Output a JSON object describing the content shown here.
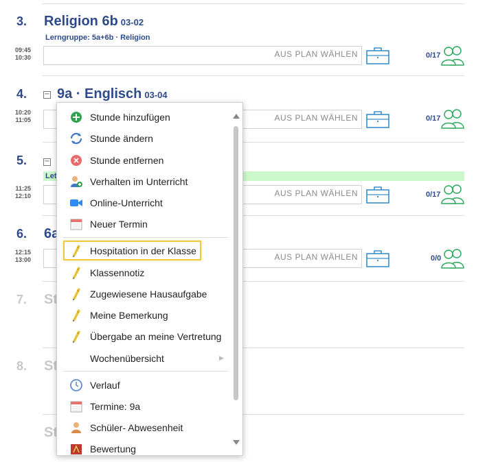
{
  "lessons": [
    {
      "number": "3.",
      "title": "Religion  6b",
      "code": "03-02",
      "subtitle": "Lerngruppe:  5a+6b · Religion",
      "time_start": "09:45",
      "time_end": "10:30",
      "plan_label": "AUS PLAN WÄHLEN",
      "count": "0/17"
    },
    {
      "number": "4.",
      "title": "9a · Englisch",
      "code": "03-04",
      "time_start": "10:20",
      "time_end": "11:05",
      "plan_label": "AUS PLAN WÄHLEN",
      "count": "0/17"
    },
    {
      "number": "5.",
      "green_text": "Let",
      "time_start": "11:25",
      "time_end": "12:10",
      "plan_label": "AUS PLAN WÄHLEN",
      "count": "0/17"
    },
    {
      "number": "6.",
      "title": "6a",
      "time_start": "12:15",
      "time_end": "13:00",
      "plan_label": "AUS PLAN WÄHLEN",
      "count": "0/0"
    },
    {
      "number": "7.",
      "title": "St"
    },
    {
      "number": "8.",
      "title": "St"
    },
    {
      "title": "St"
    }
  ],
  "menu": {
    "items": [
      {
        "label": "Stunde hinzufügen",
        "icon": "plus-circle-icon"
      },
      {
        "label": "Stunde ändern",
        "icon": "refresh-icon"
      },
      {
        "label": "Stunde entfernen",
        "icon": "remove-circle-icon"
      },
      {
        "label": "Verhalten im Unterricht",
        "icon": "person-behavior-icon"
      },
      {
        "label": "Online-Unterricht",
        "icon": "video-camera-icon"
      },
      {
        "label": "Neuer Termin",
        "icon": "calendar-icon"
      },
      {
        "label": "Hospitation in der Klasse",
        "icon": "pencil-icon"
      },
      {
        "label": "Klassennotiz",
        "icon": "pencil-icon"
      },
      {
        "label": "Zugewiesene Hausaufgabe",
        "icon": "pencil-icon"
      },
      {
        "label": "Meine Bemerkung",
        "icon": "pencil-icon"
      },
      {
        "label": "Übergabe an meine Vertretung",
        "icon": "pencil-icon"
      },
      {
        "label": "Wochenübersicht",
        "icon": "submenu-arrow-icon"
      },
      {
        "label": "Verlauf",
        "icon": "clock-icon"
      },
      {
        "label": "Termine: 9a",
        "icon": "calendar-icon"
      },
      {
        "label": "Schüler- Abwesenheit",
        "icon": "student-icon"
      },
      {
        "label": "Bewertung",
        "icon": "grade-icon"
      }
    ]
  },
  "colors": {
    "accent": "#2e4a8b",
    "green": "#2aaa5a",
    "highlight": "#f2c840",
    "green_bar": "#ccf9cc"
  }
}
